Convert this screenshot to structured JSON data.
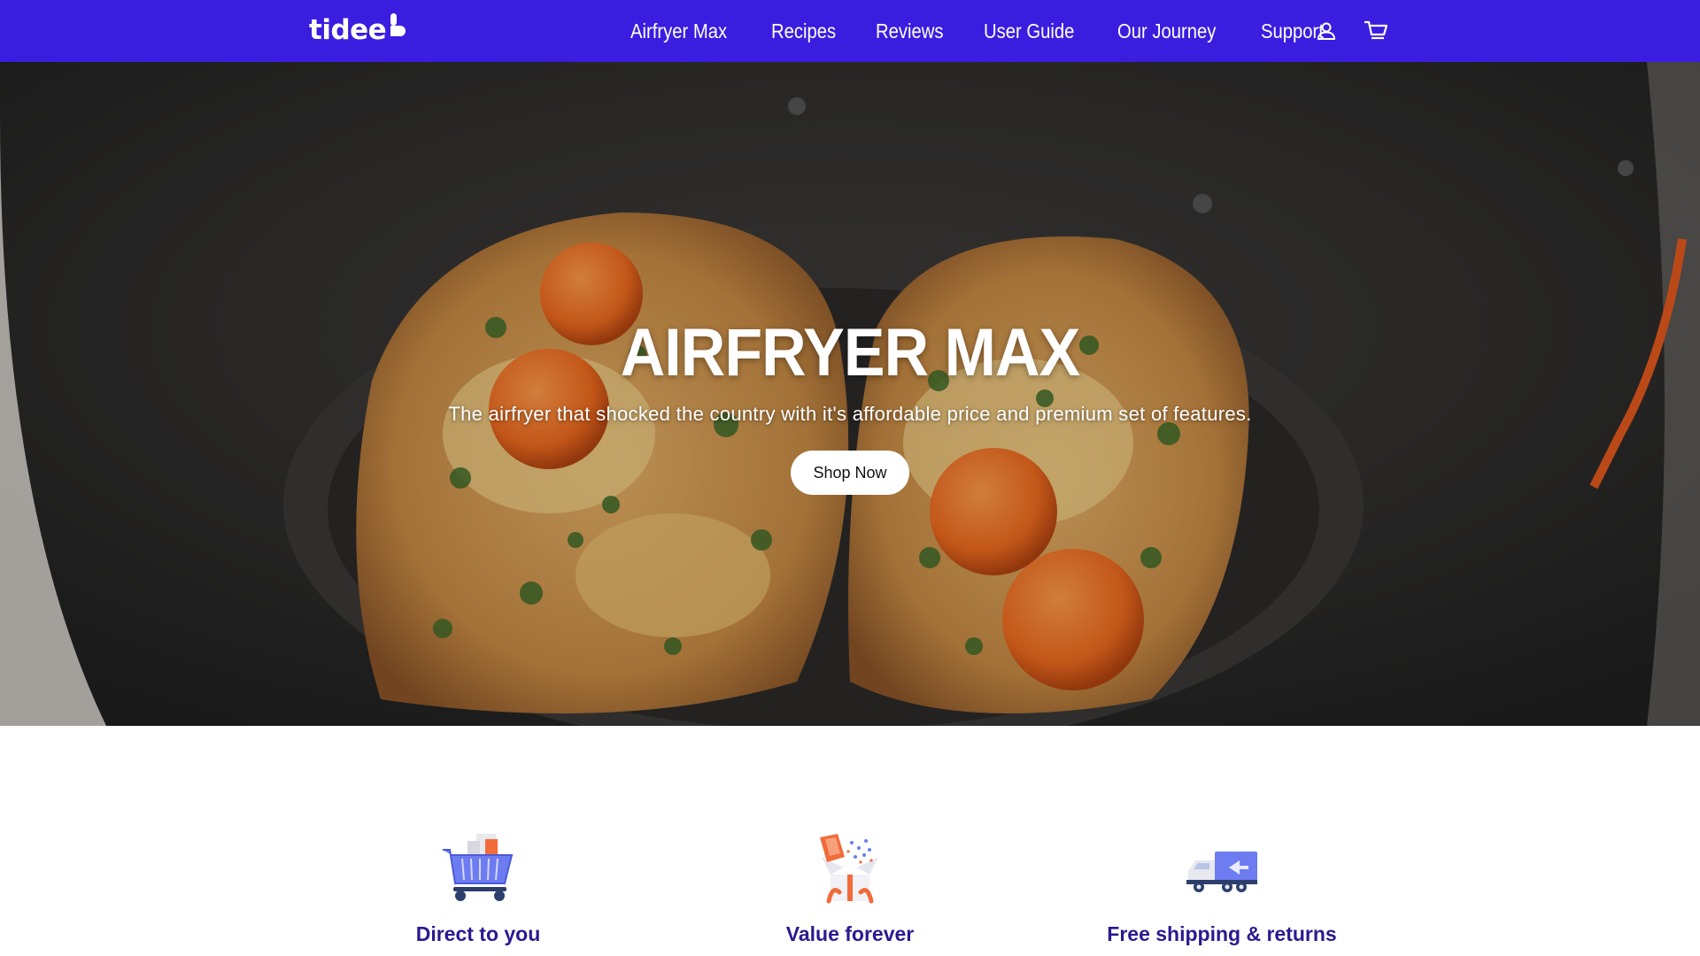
{
  "header": {
    "logo_text": "tidee",
    "nav": [
      {
        "label": "Airfryer Max"
      },
      {
        "label": "Recipes"
      },
      {
        "label": "Reviews"
      },
      {
        "label": "User Guide"
      },
      {
        "label": "Our Journey"
      },
      {
        "label": "Support"
      }
    ],
    "icons": [
      "account-icon",
      "cart-icon"
    ],
    "background_color": "#3b1de0"
  },
  "hero": {
    "title": "AIRFRYER MAX",
    "subtitle": "The airfryer that shocked the country with it's affordable price and premium set of features.",
    "button_label": "Shop Now"
  },
  "features": [
    {
      "title": "Direct to you",
      "icon": "shopping-cart-icon"
    },
    {
      "title": "Value forever",
      "icon": "gift-icon"
    },
    {
      "title": "Free shipping & returns",
      "icon": "delivery-truck-icon"
    }
  ],
  "colors": {
    "brand": "#3b1de0",
    "feature_title": "#2a1a8f",
    "accent_orange": "#f26b3a"
  }
}
